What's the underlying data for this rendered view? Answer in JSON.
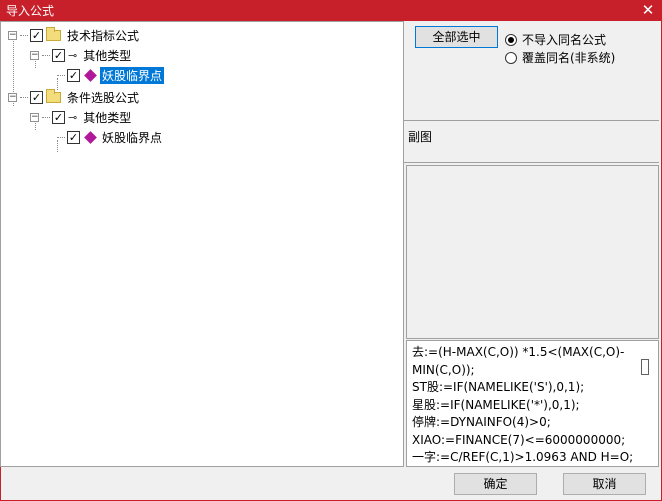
{
  "window": {
    "title": "导入公式",
    "close_glyph": "✕"
  },
  "tree": {
    "nodes": [
      {
        "label": "技术指标公式",
        "checked": true,
        "icon": "folder-icon"
      },
      {
        "label": "其他类型",
        "checked": true,
        "icon": "key-icon"
      },
      {
        "label": "妖股临界点",
        "checked": true,
        "icon": "gem-icon",
        "selected": true
      },
      {
        "label": "条件选股公式",
        "checked": true,
        "icon": "folder-icon"
      },
      {
        "label": "其他类型",
        "checked": true,
        "icon": "key-icon"
      },
      {
        "label": "妖股临界点",
        "checked": true,
        "icon": "gem-icon"
      }
    ]
  },
  "actions": {
    "select_all_label": "全部选中",
    "radio_skip_label": "不导入同名公式",
    "radio_overwrite_label": "覆盖同名(非系统)",
    "selected_radio": "skip"
  },
  "figure": {
    "label": "副图"
  },
  "code_lines": [
    "去:=(H-MAX(C,O)) *1.5<(MAX(C,O)-MIN(C,O));",
    "ST股:=IF(NAMELIKE('S'),0,1);",
    "星股:=IF(NAMELIKE('*'),0,1);",
    "停牌:=DYNAINFO(4)>0;",
    "XIAO:=FINANCE(7)<=6000000000;",
    "一字:=C/REF(C,1)>1.0963 AND H=O;"
  ],
  "footer": {
    "ok_label": "确定",
    "cancel_label": "取消"
  },
  "colors": {
    "titlebar": "#c8202a",
    "selection": "#0078d7",
    "gem": "#b0179a"
  }
}
